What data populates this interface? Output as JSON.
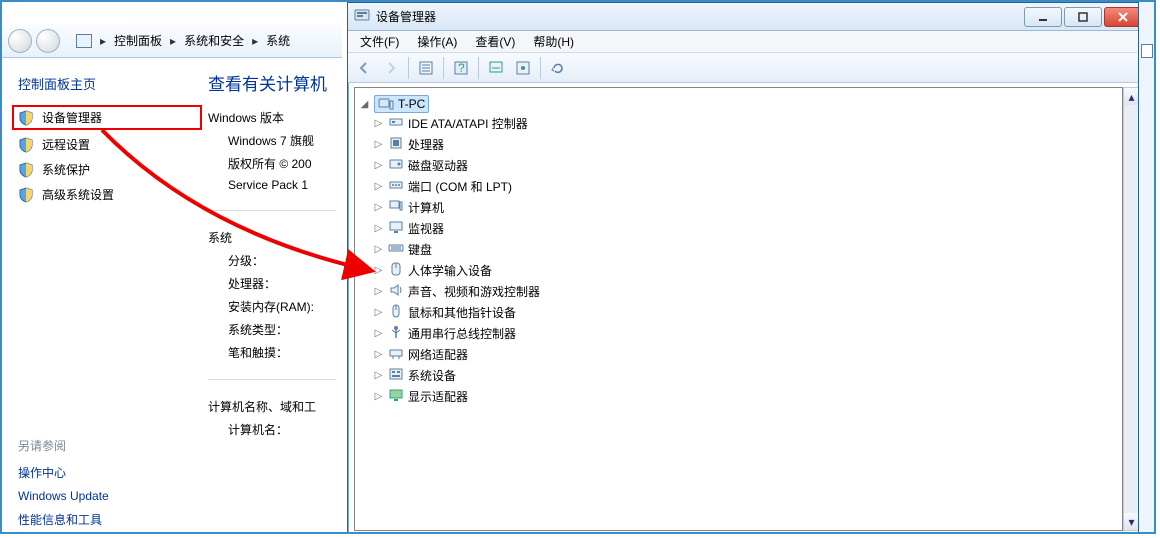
{
  "bg": {
    "breadcrumbs": [
      "控制面板",
      "系统和安全",
      "系统"
    ],
    "home": "控制面板主页",
    "side": [
      {
        "label": "设备管理器",
        "hl": true
      },
      {
        "label": "远程设置",
        "hl": false
      },
      {
        "label": "系统保护",
        "hl": false
      },
      {
        "label": "高级系统设置",
        "hl": false
      }
    ],
    "see_also_title": "另请参阅",
    "see_also": [
      "操作中心",
      "Windows Update",
      "性能信息和工具"
    ],
    "main": {
      "heading": "查看有关计算机",
      "win_edition": "Windows 版本",
      "edition_lines": [
        "Windows 7 旗舰",
        "版权所有 © 200",
        "Service Pack 1"
      ],
      "system_title": "系统",
      "rows": [
        "分级：",
        "处理器：",
        "安装内存(RAM):",
        "系统类型：",
        "笔和触摸："
      ],
      "name_title": "计算机名称、域和工",
      "name_rows": [
        "计算机名："
      ]
    }
  },
  "dm": {
    "title": "设备管理器",
    "menus": [
      "文件(F)",
      "操作(A)",
      "查看(V)",
      "帮助(H)"
    ],
    "root": "T-PC",
    "nodes": [
      {
        "label": "IDE ATA/ATAPI 控制器",
        "icon": "ide"
      },
      {
        "label": "处理器",
        "icon": "cpu"
      },
      {
        "label": "磁盘驱动器",
        "icon": "disk"
      },
      {
        "label": "端口 (COM 和 LPT)",
        "icon": "port"
      },
      {
        "label": "计算机",
        "icon": "pc"
      },
      {
        "label": "监视器",
        "icon": "monitor"
      },
      {
        "label": "键盘",
        "icon": "keyboard"
      },
      {
        "label": "人体学输入设备",
        "icon": "hid"
      },
      {
        "label": "声音、视频和游戏控制器",
        "icon": "sound"
      },
      {
        "label": "鼠标和其他指针设备",
        "icon": "mouse"
      },
      {
        "label": "通用串行总线控制器",
        "icon": "usb"
      },
      {
        "label": "网络适配器",
        "icon": "net"
      },
      {
        "label": "系统设备",
        "icon": "sys"
      },
      {
        "label": "显示适配器",
        "icon": "display"
      }
    ]
  }
}
